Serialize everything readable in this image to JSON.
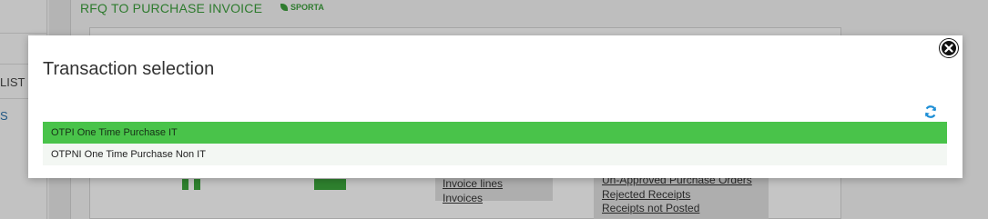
{
  "background": {
    "sidebar_items": [
      {
        "label": "LIST"
      },
      {
        "label": "S"
      }
    ],
    "page_title": "RFQ TO PURCHASE INVOICE",
    "badge": "SPORTA",
    "links_left": [
      "Invoice lines",
      "Invoices"
    ],
    "links_right": [
      "Un-Approved Purchase Orders",
      "Rejected Receipts",
      "Receipts not Posted"
    ]
  },
  "modal": {
    "title": "Transaction selection",
    "close_icon": "close-icon",
    "refresh_icon": "refresh-icon",
    "items": [
      {
        "label": "OTPI One Time Purchase IT",
        "selected": true
      },
      {
        "label": "OTPNI One Time Purchase Non IT",
        "selected": false
      }
    ]
  },
  "colors": {
    "selected_row": "#49c34a",
    "accent_green": "#3a9a3a",
    "refresh_blue": "#1e8fd6"
  }
}
